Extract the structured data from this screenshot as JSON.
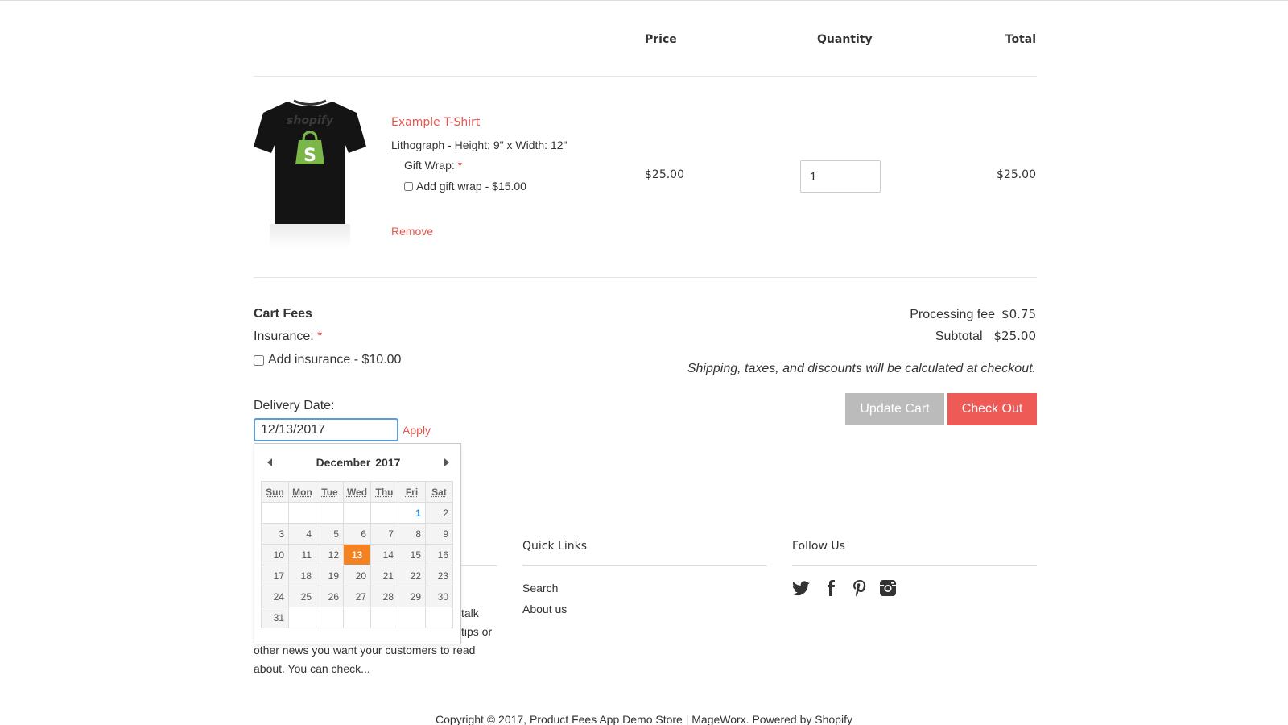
{
  "cart": {
    "header": {
      "price": "Price",
      "quantity": "Quantity",
      "total": "Total"
    },
    "item": {
      "title": "Example T-Shirt",
      "variant": "Lithograph - Height: 9\" x Width: 12\"",
      "gift_wrap_label": "Gift Wrap:",
      "required_mark": "*",
      "gift_wrap_option": "Add gift wrap - $15.00",
      "remove": "Remove",
      "price": "$25.00",
      "quantity": "1",
      "total": "$25.00",
      "shirt_logo_text": "shopify"
    }
  },
  "fees": {
    "title": "Cart Fees",
    "insurance_label": "Insurance:",
    "required_mark": "*",
    "insurance_option": "Add insurance - $10.00",
    "delivery_label": "Delivery Date:",
    "delivery_value": "12/13/2017",
    "apply": "Apply"
  },
  "summary": {
    "processing_fee_label": "Processing fee",
    "processing_fee_value": "$0.75",
    "subtotal_label": "Subtotal",
    "subtotal_value": "$25.00",
    "note": "Shipping, taxes, and discounts will be calculated at checkout.",
    "update_button": "Update Cart",
    "checkout_button": "Check Out"
  },
  "calendar": {
    "month": "December",
    "year": "2017",
    "days": [
      "Sun",
      "Mon",
      "Tue",
      "Wed",
      "Thu",
      "Fri",
      "Sat"
    ],
    "weeks": [
      [
        "",
        "",
        "",
        "",
        "",
        "1",
        "2"
      ],
      [
        "3",
        "4",
        "5",
        "6",
        "7",
        "8",
        "9"
      ],
      [
        "10",
        "11",
        "12",
        "13",
        "14",
        "15",
        "16"
      ],
      [
        "17",
        "18",
        "19",
        "20",
        "21",
        "22",
        "23"
      ],
      [
        "24",
        "25",
        "26",
        "27",
        "28",
        "29",
        "30"
      ],
      [
        "31",
        "",
        "",
        "",
        "",
        "",
        ""
      ]
    ],
    "today": "1",
    "selected": "13"
  },
  "footer": {
    "quick_links_title": "Quick Links",
    "links": [
      "Search",
      "About us"
    ],
    "follow_title": "Follow Us",
    "social_icons": [
      "twitter-icon",
      "facebook-icon",
      "pinterest-icon",
      "instagram-icon"
    ],
    "blog_lines": [
      "talk",
      "tips or",
      "other news you want your customers to read",
      "about. You can check..."
    ],
    "copyright": "Copyright © 2017, Product Fees App Demo Store | MageWorx. Powered by Shopify"
  },
  "colors": {
    "accent": "#e4564e",
    "checkout": "#ee5b57",
    "update": "#bbbbbb",
    "selected_day": "#f58220",
    "input_focus": "#5b9dd9"
  }
}
